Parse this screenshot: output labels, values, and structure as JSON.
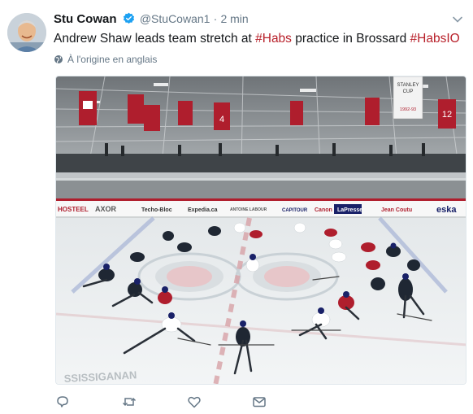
{
  "tweet": {
    "author_name": "Stu Cowan",
    "handle": "@StuCowan1",
    "separator": "·",
    "time": "2 min",
    "text_parts": [
      "Andrew Shaw leads team stretch at ",
      "#Habs",
      " practice in Brossard ",
      "#HabsIO"
    ],
    "translate_label": "À l'origine en anglais"
  },
  "photo": {
    "boards_ads": [
      "HOSTEEL",
      "AXOR",
      "Techo-Bloc",
      "Expedia.ca",
      "ANTOINE LABOUR",
      "CAPITOUR",
      "Canon",
      "LaPresse",
      "Jean Coutu",
      "eska"
    ],
    "banner_numbers": [
      "4",
      "12"
    ],
    "banner_text": [
      "STANLEY",
      "CUP",
      "1992-93"
    ],
    "ice_text": "SSISSIGANAN"
  },
  "colors": {
    "hashtag": "#b8202a",
    "verified": "#1da1f2",
    "muted": "#657786",
    "habs_red": "#af1e2d",
    "habs_blue": "#192168"
  },
  "icons": [
    "verified-badge-icon",
    "chevron-down-icon",
    "globe-icon",
    "reply-icon",
    "retweet-icon",
    "like-icon",
    "message-icon"
  ]
}
